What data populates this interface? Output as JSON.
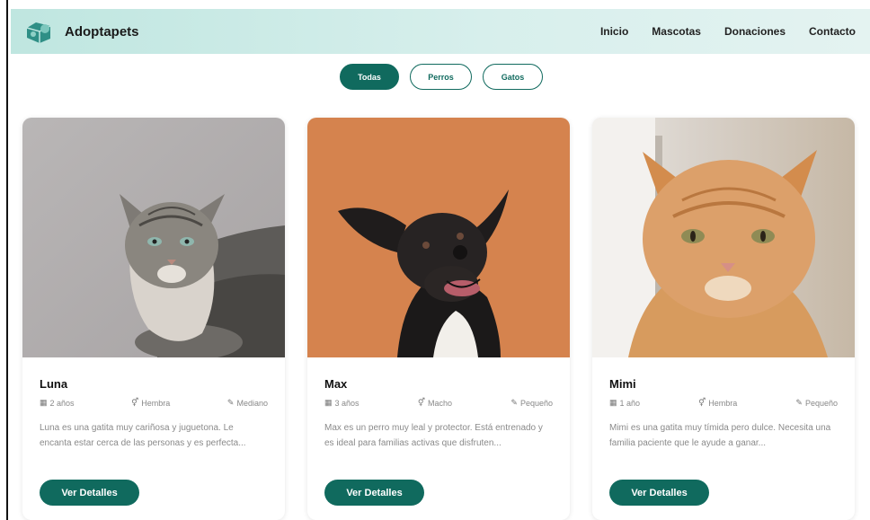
{
  "brand": {
    "name": "Adoptapets",
    "logo_icon": "pet-logo-icon"
  },
  "nav": {
    "links": [
      "Inicio",
      "Mascotas",
      "Donaciones",
      "Contacto"
    ]
  },
  "filters": [
    {
      "label": "Todas",
      "active": true
    },
    {
      "label": "Perros",
      "active": false
    },
    {
      "label": "Gatos",
      "active": false
    }
  ],
  "pets": [
    {
      "name": "Luna",
      "age": "2 años",
      "sex": "Hembra",
      "size": "Mediano",
      "description": "Luna es una gatita muy cariñosa y juguetona. Le encanta estar cerca de las personas y es perfecta...",
      "button": "Ver Detalles",
      "photo": "gray tabby cat"
    },
    {
      "name": "Max",
      "age": "3 años",
      "sex": "Macho",
      "size": "Pequeño",
      "description": "Max es un perro muy leal y protector. Está entrenado y es ideal para familias activas que disfruten...",
      "button": "Ver Detalles",
      "photo": "black and white dog on orange background"
    },
    {
      "name": "Mimi",
      "age": "1 año",
      "sex": "Hembra",
      "size": "Pequeño",
      "description": "Mimi es una gatita muy tímida pero dulce. Necesita una familia paciente que le ayude a ganar...",
      "button": "Ver Detalles",
      "photo": "orange tabby cat"
    }
  ],
  "colors": {
    "accent": "#106a5e",
    "navbar": "#c9ebe6"
  }
}
